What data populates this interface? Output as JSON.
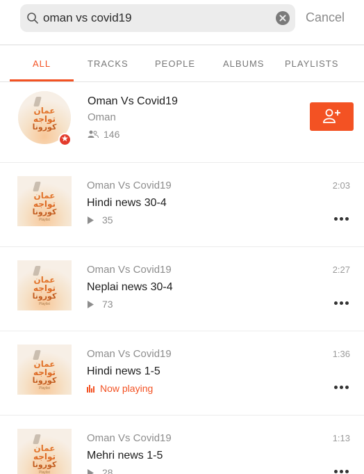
{
  "search": {
    "query": "oman vs covid19",
    "cancel_label": "Cancel"
  },
  "tabs": [
    {
      "label": "ALL",
      "active": true
    },
    {
      "label": "TRACKS",
      "active": false
    },
    {
      "label": "PEOPLE",
      "active": false
    },
    {
      "label": "ALBUMS",
      "active": false
    },
    {
      "label": "PLAYLISTS",
      "active": false
    }
  ],
  "user_result": {
    "name": "Oman Vs Covid19",
    "subtitle": "Oman",
    "followers": "146",
    "cover_text": {
      "line1": "عمان",
      "line2": "تواجه",
      "line3": "كورونا"
    },
    "icons": [
      "followers-icon",
      "follow-user-icon",
      "star-badge-icon"
    ]
  },
  "tracks": [
    {
      "artist": "Oman Vs Covid19",
      "title": "Hindi news 30-4",
      "plays": "35",
      "duration": "2:03",
      "now_playing": false
    },
    {
      "artist": "Oman Vs Covid19",
      "title": "Neplai news 30-4",
      "plays": "73",
      "duration": "2:27",
      "now_playing": false
    },
    {
      "artist": "Oman Vs Covid19",
      "title": "Hindi news 1-5",
      "plays": "",
      "duration": "1:36",
      "now_playing": true,
      "now_playing_label": "Now playing"
    },
    {
      "artist": "Oman Vs Covid19",
      "title": "Mehri news 1-5",
      "plays": "28",
      "duration": "1:13",
      "now_playing": false
    }
  ],
  "cover_text": {
    "line1": "عمان",
    "line2": "تواجه",
    "line3": "كورونا",
    "tag": "Playlist"
  },
  "colors": {
    "accent": "#f35223",
    "badge": "#e33b2c"
  }
}
